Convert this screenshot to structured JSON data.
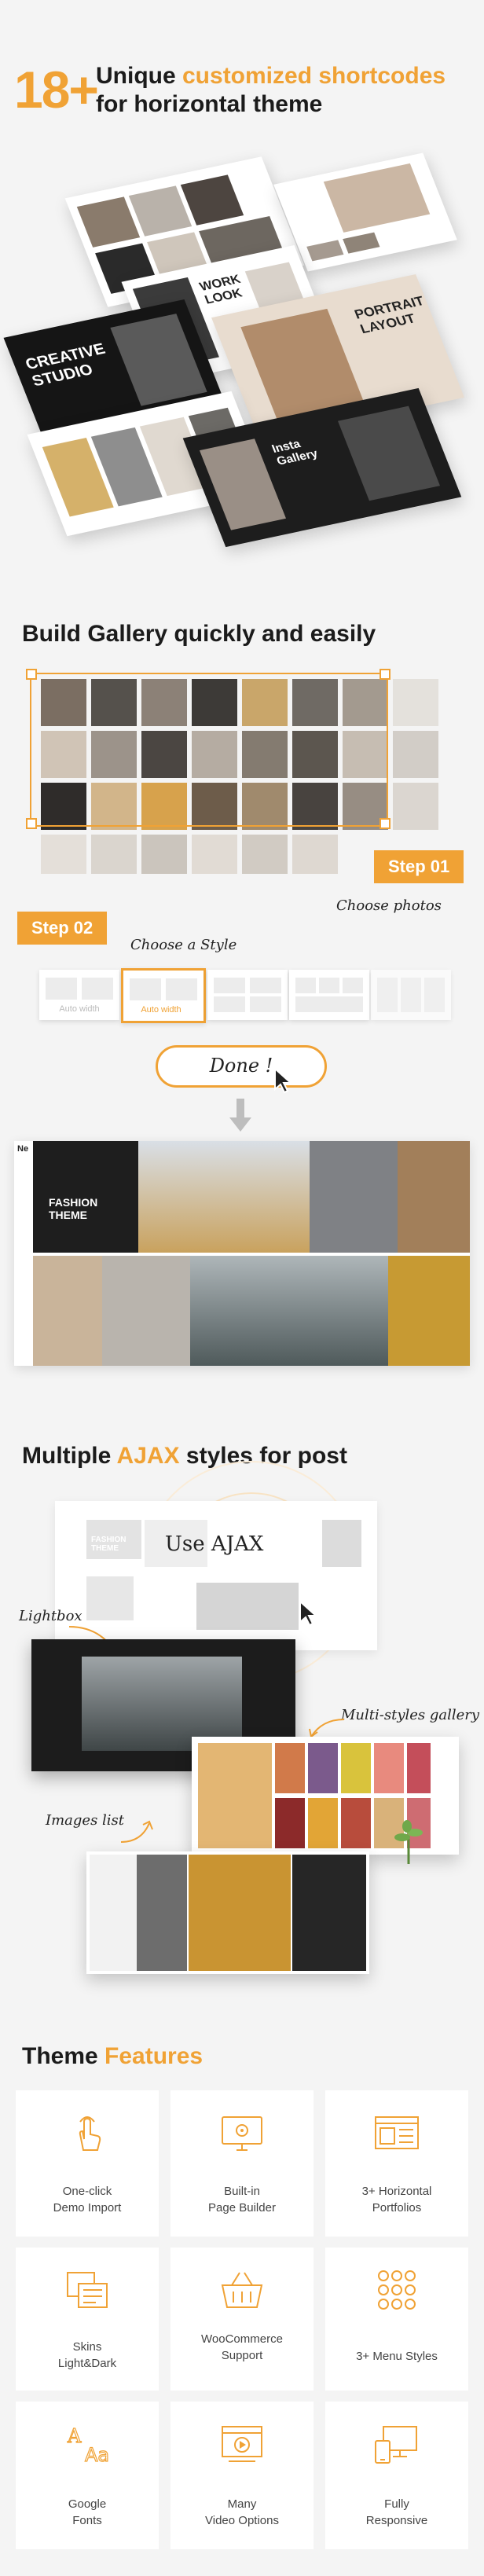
{
  "header": {
    "count": "18+",
    "line1_prefix": "Unique ",
    "line1_highlight": "customized shortcodes",
    "line2": "for horizontal theme"
  },
  "mockups": {
    "card_a": "WORK\nLOOK",
    "card_b": "CREATIVE\nSTUDIO",
    "card_c": "PORTRAIT\nLAYOUT",
    "card_d": "Insta\nGallery"
  },
  "build": {
    "title": "Build Gallery quickly and easily",
    "step1": "Step 01",
    "choose_photos": "Choose photos",
    "step2": "Step 02",
    "choose_style": "Choose a Style",
    "style_opt1": "Auto width",
    "style_opt2": "Auto width",
    "done": "Done !",
    "logo": "Ne",
    "fashion_title": "FASHION\nTHEME"
  },
  "ajax": {
    "title_prefix": "Multiple ",
    "title_highlight": "AJAX",
    "title_suffix": " styles for post",
    "use_ajax": "Use AJAX",
    "lightbox": "Lightbox",
    "multi": "Multi-styles gallery",
    "images_list": "Images list",
    "page_title": "FASHION\nTHEME"
  },
  "features": {
    "title_prefix": "Theme ",
    "title_highlight": "Features",
    "items": [
      {
        "label": "One-click\nDemo Import",
        "icon": "hand-click-icon"
      },
      {
        "label": "Built-in\nPage Builder",
        "icon": "monitor-gear-icon"
      },
      {
        "label": "3+ Horizontal\nPortfolios",
        "icon": "layout-icon"
      },
      {
        "label": "Skins\nLight&Dark",
        "icon": "skins-icon"
      },
      {
        "label": "WooCommerce\nSupport",
        "icon": "basket-icon"
      },
      {
        "label": "3+ Menu Styles",
        "icon": "dots-grid-icon"
      },
      {
        "label": "Google\nFonts",
        "icon": "fonts-icon"
      },
      {
        "label": "Many\nVideo Options",
        "icon": "video-icon"
      },
      {
        "label": "Fully\nResponsive",
        "icon": "responsive-icon"
      }
    ]
  },
  "colors": {
    "accent": "#f0a235",
    "text": "#1b1b1b",
    "bg": "#f4f4f4"
  }
}
